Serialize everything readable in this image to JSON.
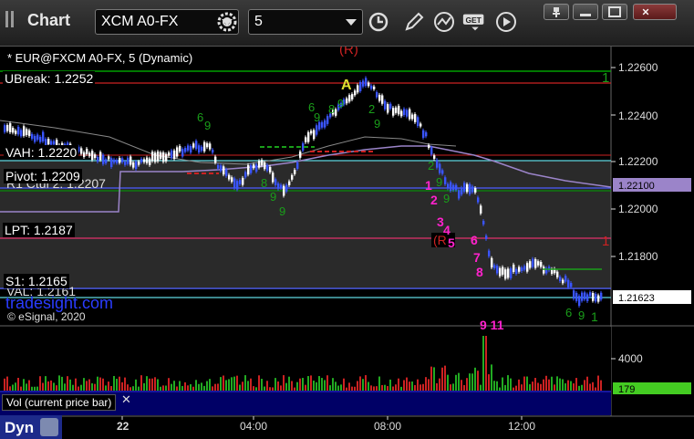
{
  "window": {
    "title": "Chart",
    "symbol_input": "XCM A0-FX",
    "interval_input": "5"
  },
  "toolbar": {
    "icons": [
      "settings-gear-icon",
      "clock-icon",
      "pencil-icon",
      "line-chart-icon",
      "get-menu-icon",
      "play-icon"
    ],
    "get_label": "GET"
  },
  "window_controls": [
    "pin-icon",
    "minimize-icon",
    "maximize-icon",
    "close-icon"
  ],
  "chart": {
    "header": "* EUR@FXCM A0-FX, 5 (Dynamic)",
    "watermark": "tradesight.com",
    "copyright": "© eSignal, 2020",
    "level_labels": [
      {
        "key": "ubreak",
        "text": "UBreak: 1.2252"
      },
      {
        "key": "vah",
        "text": "VAH: 1.2220"
      },
      {
        "key": "pivot",
        "text": "Pivot: 1.2209"
      },
      {
        "key": "r1",
        "text": "R1 Ctul 2: 1.2207"
      },
      {
        "key": "lpt",
        "text": "LPT: 1.2187"
      },
      {
        "key": "s1",
        "text": "S1: 1.2165"
      },
      {
        "key": "val",
        "text": "VAL: 1.2161"
      }
    ],
    "price_axis": [
      "1.22600",
      "1.22400",
      "1.22200",
      "1.22000",
      "1.21800"
    ],
    "price_labels": [
      {
        "text": "1.22100",
        "bg": "#9b84c9",
        "color": "#000"
      },
      {
        "text": "1.21623",
        "bg": "#ffffff",
        "color": "#000"
      }
    ],
    "time_axis": [
      "22",
      "04:00",
      "08:00",
      "12:00"
    ],
    "volume_axis": "4000",
    "volume_value": "179",
    "volume_legend": "Vol (current price bar)",
    "annotations": {
      "r_top": "(R)",
      "a_marker": "A",
      "red_one": "1",
      "magenta_counts": [
        "1",
        "2",
        "3",
        "4",
        "5",
        "6",
        "7",
        "8"
      ],
      "magenta_bottom": "9   11"
    }
  },
  "footer": {
    "label": "Dyn"
  },
  "colors": {
    "background": "#000000",
    "ubreak_line": "#00c000",
    "red_line": "#cc2222",
    "blue_line": "#4a5cff",
    "cyan_line": "#5fd7e0",
    "purple_line": "#9b84c9",
    "magenta_line": "#e0306a",
    "up_bar": "#ffffff",
    "down_bar": "#3a55ff",
    "setup_green": "#1a9e1a",
    "magenta_text": "#ff22cc",
    "volume_panel": "#000066"
  }
}
